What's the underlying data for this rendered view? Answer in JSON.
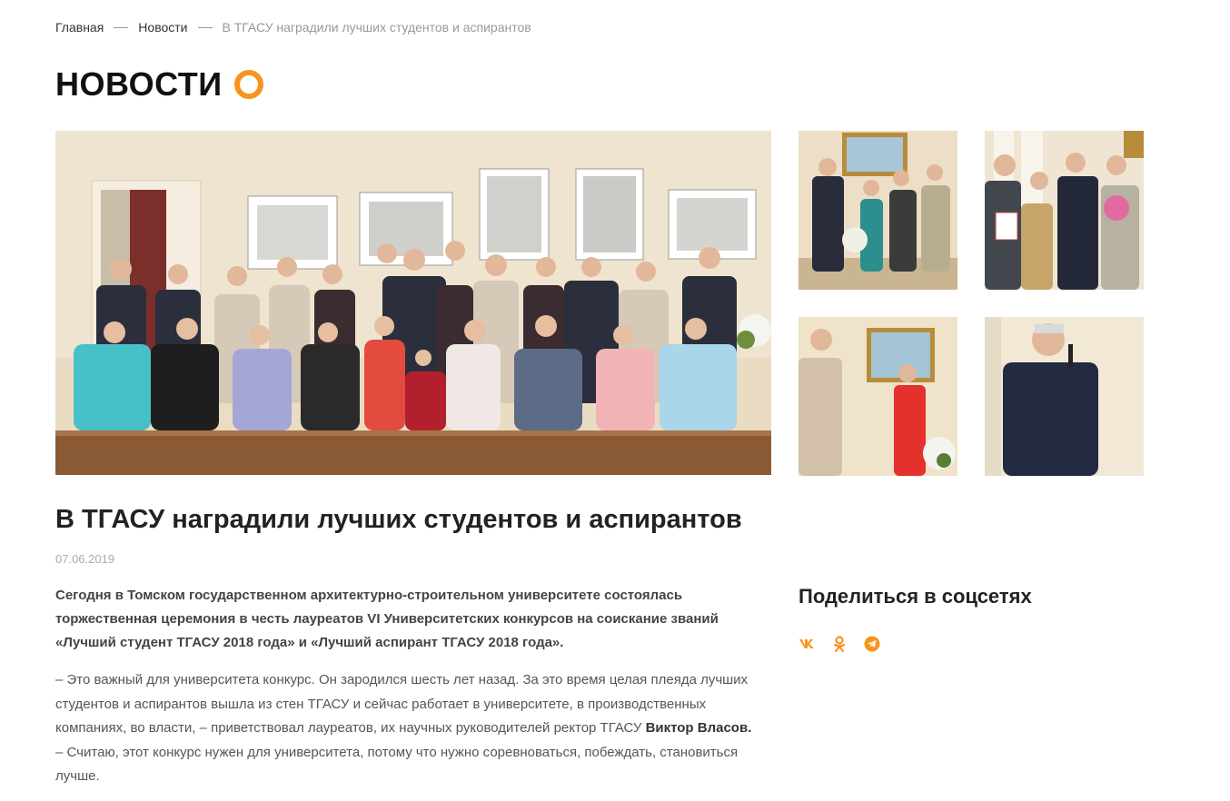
{
  "breadcrumb": {
    "items": [
      "Главная",
      "Новости"
    ],
    "current": "В ТГАСУ наградили лучших студентов и аспирантов"
  },
  "page": {
    "title": "НОВОСТИ",
    "accent_color": "#f7941d"
  },
  "gallery": {
    "main_photo": "group-photo",
    "thumbnails": [
      "award-ceremony-photo-1",
      "award-ceremony-photo-2",
      "speaker-photo",
      "speaker-with-microphone-photo"
    ]
  },
  "article": {
    "title": "В ТГАСУ наградили лучших студентов и аспирантов",
    "date": "07.06.2019",
    "lead": "Сегодня в Томском государственном архитектурно-строительном университете состоялась торжественная церемония в честь лауреатов VI Университетских конкурсов на соискание званий «Лучший студент ТГАСУ 2018 года» и «Лучший аспирант ТГАСУ 2018 года».",
    "body_part1": "– Это важный для университета конкурс. Он зародился шесть лет назад. За это время целая плеяда лучших студентов и аспирантов вышла из стен ТГАСУ и сейчас работает в университете, в производственных компаниях, во власти, – приветствовал лауреатов, их научных руководителей ректор ТГАСУ ",
    "body_bold": "Виктор Власов.",
    "body_part2": " – Считаю, этот конкурс нужен для университета, потому что нужно соревноваться, побеждать, становиться лучше."
  },
  "share": {
    "title": "Поделиться в соцсетях",
    "icons": [
      "vk-icon",
      "odnoklassniki-icon",
      "telegram-icon"
    ]
  }
}
